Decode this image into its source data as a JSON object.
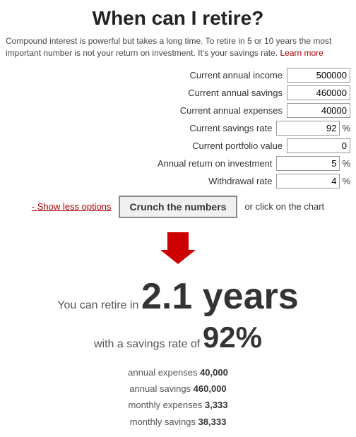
{
  "title": "When can I retire?",
  "intro": {
    "text": "Compound interest is powerful but takes a long time. To retire in 5 or 10 years the most important number is not your return on investment. It's your savings rate.",
    "learn_more_label": "Learn more",
    "learn_more_url": "#"
  },
  "form": {
    "fields": [
      {
        "id": "annual-income",
        "label": "Current annual income",
        "value": "500000",
        "unit": ""
      },
      {
        "id": "annual-savings",
        "label": "Current annual savings",
        "value": "460000",
        "unit": ""
      },
      {
        "id": "annual-expenses",
        "label": "Current annual expenses",
        "value": "40000",
        "unit": ""
      },
      {
        "id": "savings-rate",
        "label": "Current savings rate",
        "value": "92",
        "unit": "%"
      },
      {
        "id": "portfolio-value",
        "label": "Current portfolio value",
        "value": "0",
        "unit": ""
      },
      {
        "id": "roi",
        "label": "Annual return on investment",
        "value": "5",
        "unit": "%"
      },
      {
        "id": "withdrawal-rate",
        "label": "Withdrawal rate",
        "value": "4",
        "unit": "%"
      }
    ],
    "show_less_label": "- Show less options",
    "crunch_label": "Crunch the numbers",
    "or_click_label": "or click on the chart"
  },
  "result": {
    "retire_prefix": "You can retire in",
    "retire_value": "2.1 years",
    "savings_prefix": "with a savings rate of",
    "savings_value": "92%"
  },
  "stats": [
    {
      "label": "annual expenses",
      "value": "40,000"
    },
    {
      "label": "annual savings",
      "value": "460,000"
    },
    {
      "label": "monthly expenses",
      "value": "3,333"
    },
    {
      "label": "monthly savings",
      "value": "38,333"
    }
  ]
}
